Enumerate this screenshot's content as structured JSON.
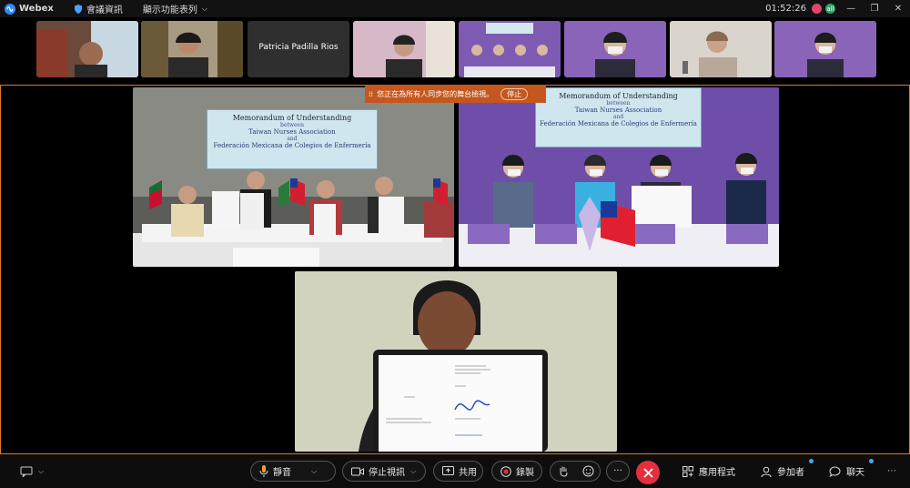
{
  "titlebar": {
    "brand": "Webex",
    "meeting_info": "會議資訊",
    "show_menu": "顯示功能表列",
    "time": "01:52:26",
    "badge_a": "",
    "badge_b": "all"
  },
  "participants": [
    {
      "name": ""
    },
    {
      "name": ""
    },
    {
      "name": "Patricia Padilla Rios"
    },
    {
      "name": ""
    },
    {
      "name": ""
    },
    {
      "name": ""
    },
    {
      "name": ""
    },
    {
      "name": ""
    }
  ],
  "share_notice": {
    "text": "您正在為所有人同步您的舞台檢視。",
    "stop_label": "停止"
  },
  "stage": {
    "banner_left": {
      "title": "Memorandum of Understanding",
      "between": "between",
      "org1": "Taiwan Nurses Association",
      "and": "and",
      "org2": "Federación Mexicana de Colegios de Enfermería"
    },
    "banner_right": {
      "title": "Memorandum of Understanding",
      "between": "between",
      "org1": "Taiwan Nurses Association",
      "and": "and",
      "org2": "Federación Mexicana de Colegios de Enfermería"
    }
  },
  "toolbar": {
    "mute_label": "靜音",
    "stop_video_label": "停止視訊",
    "share_label": "共用",
    "record_label": "錄製",
    "apps_label": "應用程式",
    "participants_label": "參加者",
    "chat_label": "聊天",
    "more_label": "···"
  },
  "colors": {
    "accent_border": "#d97a2b",
    "end_call": "#e3303d",
    "share_banner": "#c4571e"
  }
}
